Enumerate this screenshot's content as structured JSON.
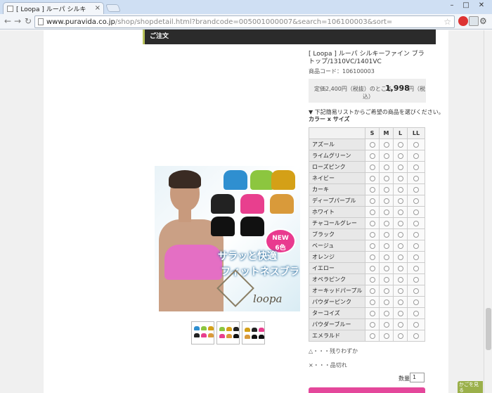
{
  "browser": {
    "tab_title": "[ Loopa ] ルーパ シルキ",
    "url_host": "www.puravida.co.jp",
    "url_path": "/shop/shopdetail.html?brandcode=005001000007&search=106100003&sort="
  },
  "section": {
    "title": "ご注文"
  },
  "product": {
    "title": "[ Loopa ] ルーパ シルキーファイン ブラトップ/1310VC/1401VC",
    "code": "商品コード：106100003",
    "regular_price": "定価2,400円（税抜）のところ",
    "sale_price": "1,998",
    "sale_unit": "円（税",
    "sale_unit_cont": "込）",
    "select_note": "▼ 下記簡易リストからご希望の商品を選びください。",
    "option_label": "カラー x サイズ"
  },
  "image": {
    "new_badge_1": "NEW",
    "new_badge_2": "6色",
    "catch_1": "サラッと快適",
    "catch_2": "フィットネスブラ",
    "logo": "loopa"
  },
  "swatch_colors": [
    "#2f8fd0",
    "#8cc63f",
    "#d4a017",
    "#222222",
    "#e83f8e",
    "#d99a3a",
    "#111111",
    "#111111",
    "#e46fc4"
  ],
  "table": {
    "sizes": [
      "S",
      "M",
      "L",
      "LL"
    ],
    "colors": [
      "アズール",
      "ライムグリーン",
      "ローズピンク",
      "ネイビー",
      "カーキ",
      "ディープパープル",
      "ホワイト",
      "チャコールグレー",
      "ブラック",
      "ベージュ",
      "オレンジ",
      "イエロー",
      "オペラピンク",
      "オーキッドパープル",
      "パウダーピンク",
      "ターコイズ",
      "パウダーブルー",
      "エメラルド"
    ]
  },
  "legend": {
    "low_stock": "△・・・残りわずか",
    "sold_out": "×・・・品切れ"
  },
  "quantity": {
    "label": "数量",
    "value": "1"
  },
  "side_badge": "かごを見る"
}
